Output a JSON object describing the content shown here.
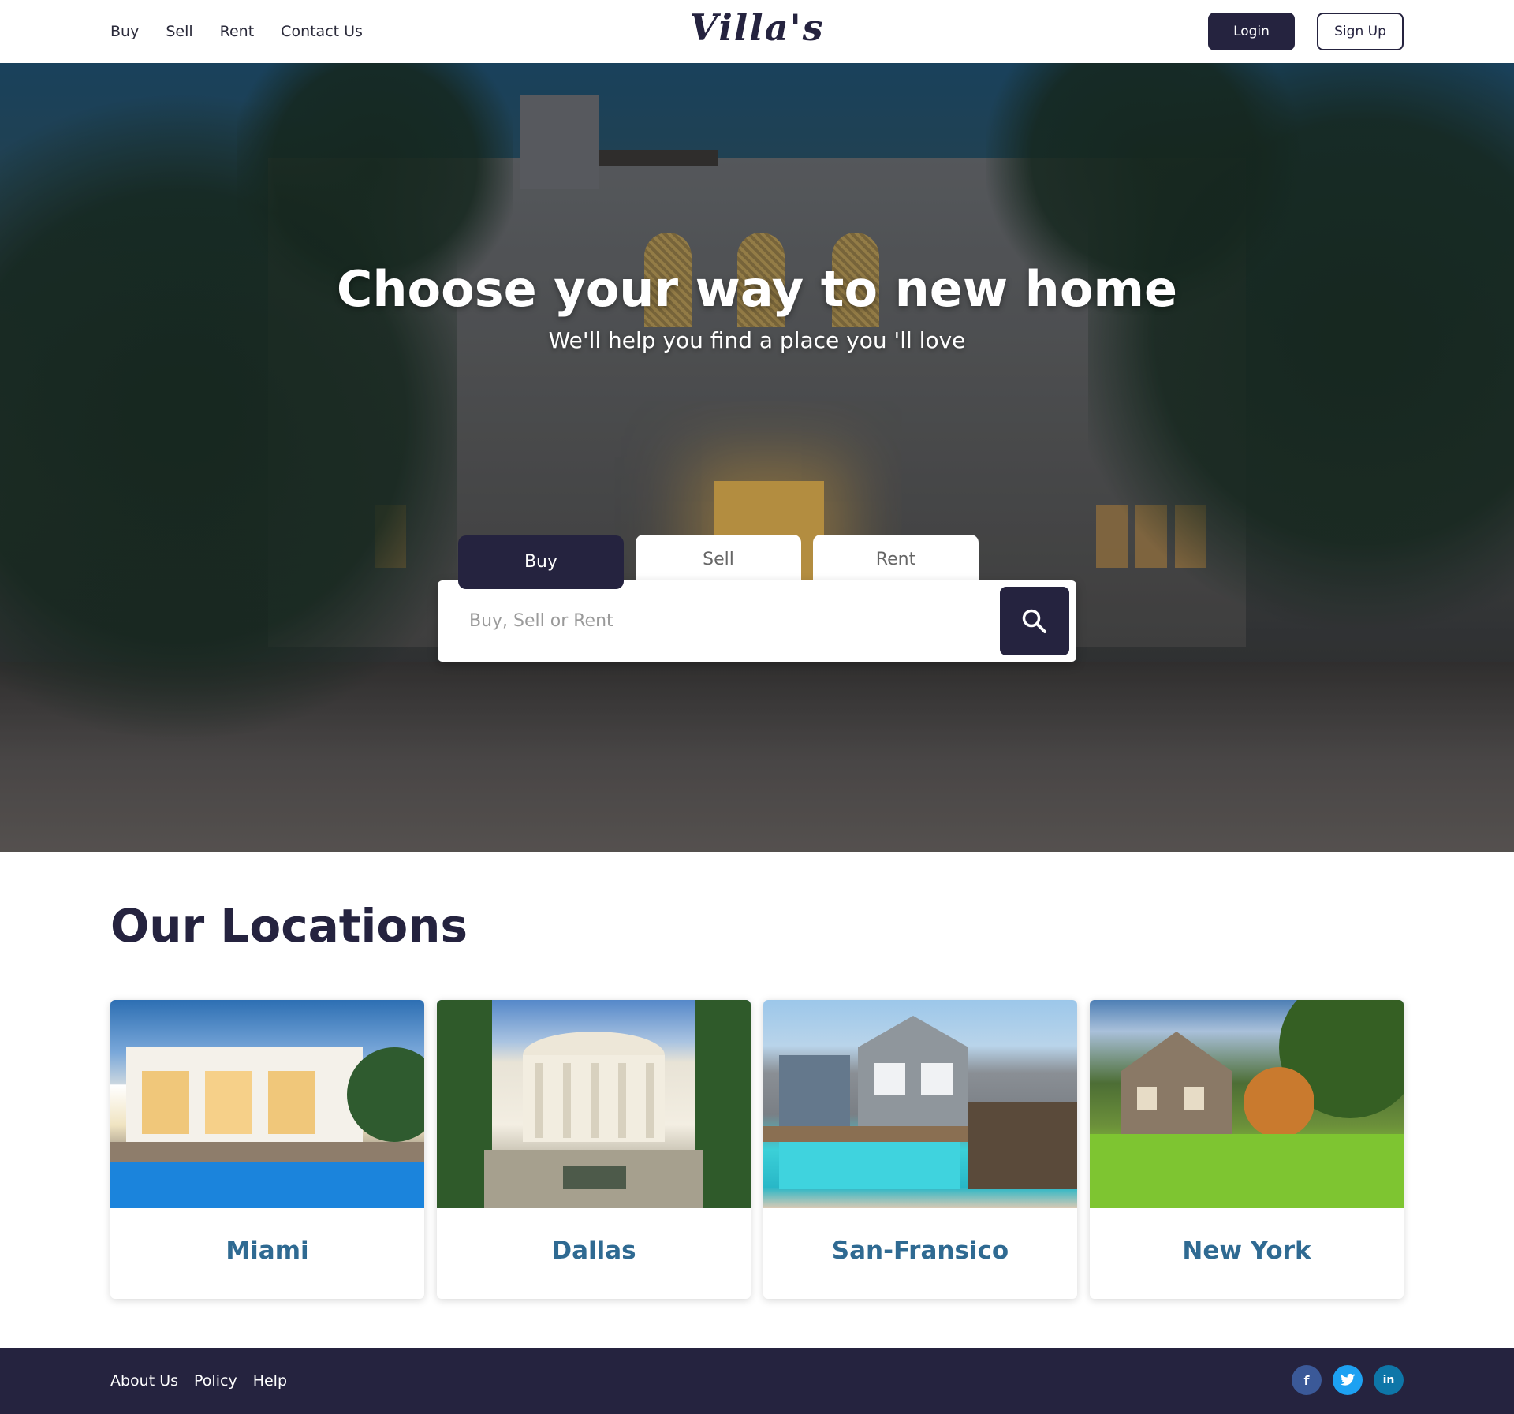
{
  "header": {
    "nav": [
      "Buy",
      "Sell",
      "Rent",
      "Contact Us"
    ],
    "logo": "Villa's",
    "login": "Login",
    "signup": "Sign Up"
  },
  "hero": {
    "title": "Choose your way to new home",
    "subtitle": "We'll help you find a place you 'll love",
    "tabs": [
      "Buy",
      "Sell",
      "Rent"
    ],
    "active_tab": "Buy",
    "search_placeholder": "Buy, Sell or Rent",
    "search_icon": "search-icon"
  },
  "locations": {
    "title": "Our Locations",
    "cards": [
      {
        "name": "Miami"
      },
      {
        "name": "Dallas"
      },
      {
        "name": "San-Fransico"
      },
      {
        "name": "New York"
      }
    ]
  },
  "footer": {
    "links": [
      "About Us",
      "Policy",
      "Help"
    ],
    "social": [
      {
        "icon": "facebook-icon",
        "glyph": "f",
        "color": "#3b5998"
      },
      {
        "icon": "twitter-icon",
        "glyph": "t",
        "color": "#1da1f2"
      },
      {
        "icon": "linkedin-icon",
        "glyph": "in",
        "color": "#0e76a8"
      }
    ]
  },
  "colors": {
    "primary": "#25233f",
    "accent_text": "#2f6a92"
  }
}
